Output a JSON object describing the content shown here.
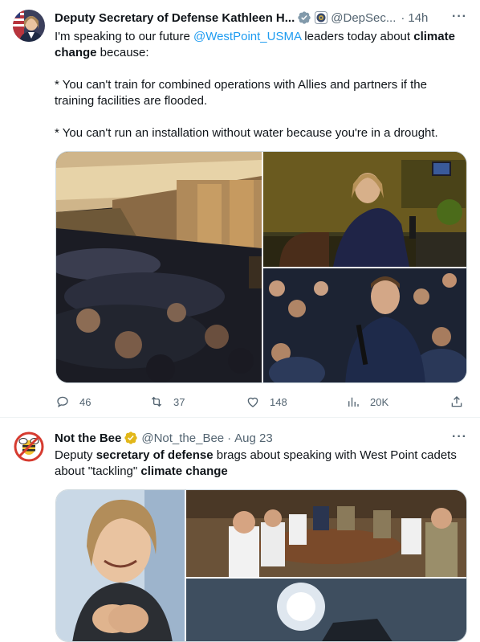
{
  "tweet1": {
    "author_name": "Deputy Secretary of Defense Kathleen H...",
    "handle": "@DepSec...",
    "separator": "·",
    "time": "14h",
    "more": "···",
    "text": {
      "p1_a": "I'm speaking to our future ",
      "p1_mention": "@WestPoint_USMA",
      "p1_b": " leaders today about ",
      "p1_bold1": "climate change",
      "p1_c": " because:",
      "p2": "* You can't train for combined operations with Allies and partners if the training facilities are flooded.",
      "p3": "* You can't run an installation without water because you're in a drought."
    },
    "actions": {
      "replies": "46",
      "retweets": "37",
      "likes": "148",
      "views": "20K"
    }
  },
  "tweet2": {
    "author_name": "Not the Bee",
    "handle": "@Not_the_Bee",
    "separator": "·",
    "time": "Aug 23",
    "more": "···",
    "text": {
      "a": "Deputy ",
      "bold1": "secretary of defense",
      "b": " brags about speaking with West Point cadets about \"tackling\" ",
      "bold2": "climate change"
    }
  },
  "colors": {
    "accent": "#1d9bf0",
    "muted": "#536471",
    "verified_gold": "#e2b719",
    "border": "#eff3f4"
  },
  "icons": [
    "reply-icon",
    "retweet-icon",
    "like-icon",
    "views-icon",
    "share-icon",
    "verified-badge-icon",
    "gov-affiliate-icon",
    "more-icon"
  ]
}
